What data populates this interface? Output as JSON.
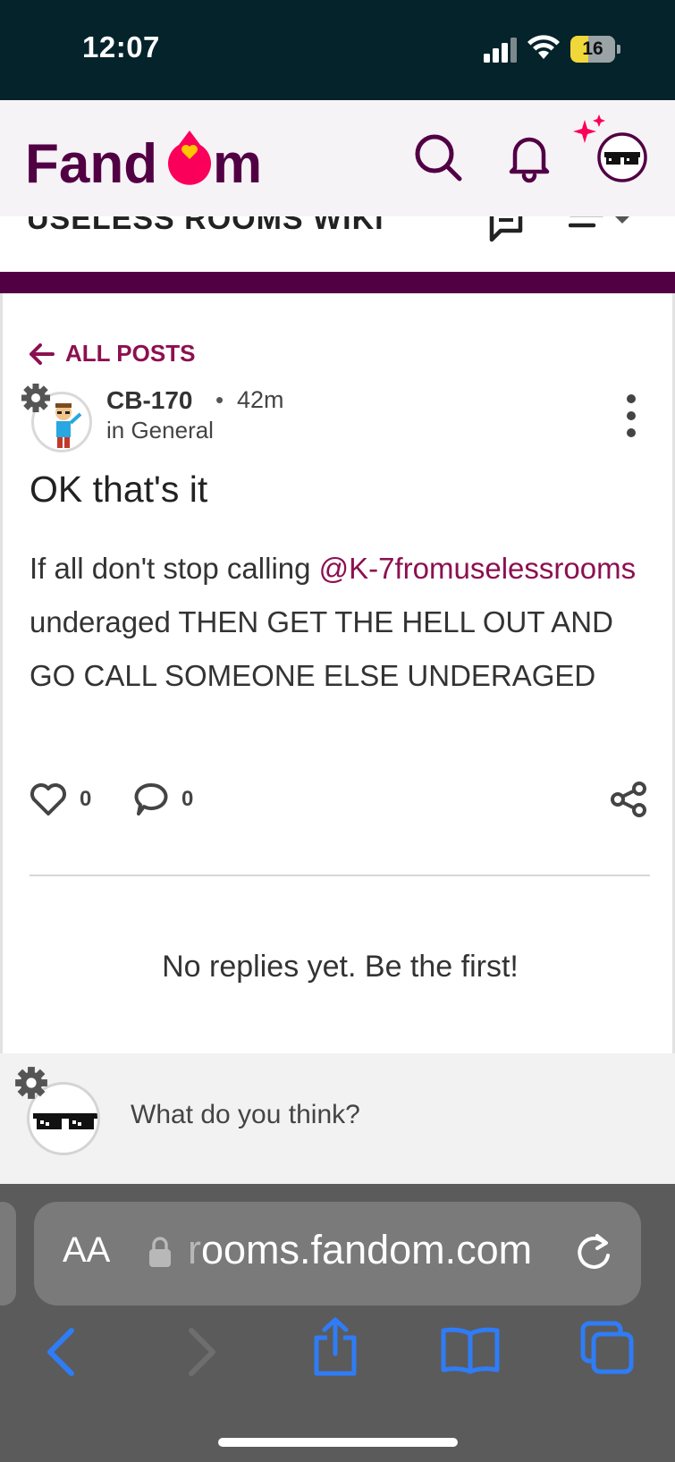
{
  "status_bar": {
    "time": "12:07",
    "battery": "16"
  },
  "header": {
    "logo_text": "Fandom",
    "brand_color": "#520044",
    "accent_color": "#fa005a"
  },
  "wiki": {
    "title": "USELESS ROOMS WIKI"
  },
  "post": {
    "back_label": "ALL POSTS",
    "author": "CB-170",
    "separator": "•",
    "time_ago": "42m",
    "category": "in General",
    "title": "OK that's it",
    "body_before": "If all don't stop calling ",
    "mention": "@K-7fromuselessrooms",
    "body_after": " underaged THEN GET THE HELL OUT AND GO CALL SOMEONE ELSE UNDERAGED",
    "likes": "0",
    "replies": "0",
    "no_replies": "No replies yet. Be the first!"
  },
  "composer": {
    "placeholder": "What do you think?"
  },
  "browser": {
    "aa_label": "AA",
    "url_fade": "r",
    "url": "ooms.fandom.com"
  },
  "icons": {
    "status": [
      "signal-icon",
      "wifi-icon",
      "battery-icon"
    ],
    "header": [
      "search-icon",
      "bell-icon",
      "avatar-sparkle-icon"
    ],
    "wiki_bar": [
      "discussions-icon",
      "menu-icon"
    ],
    "post": [
      "arrow-left-icon",
      "gear-icon",
      "more-vertical-icon",
      "heart-icon",
      "comment-icon",
      "share-icon"
    ],
    "browser": [
      "lock-icon",
      "reload-icon",
      "back-icon",
      "forward-icon",
      "share-icon",
      "bookmarks-icon",
      "tabs-icon"
    ]
  }
}
